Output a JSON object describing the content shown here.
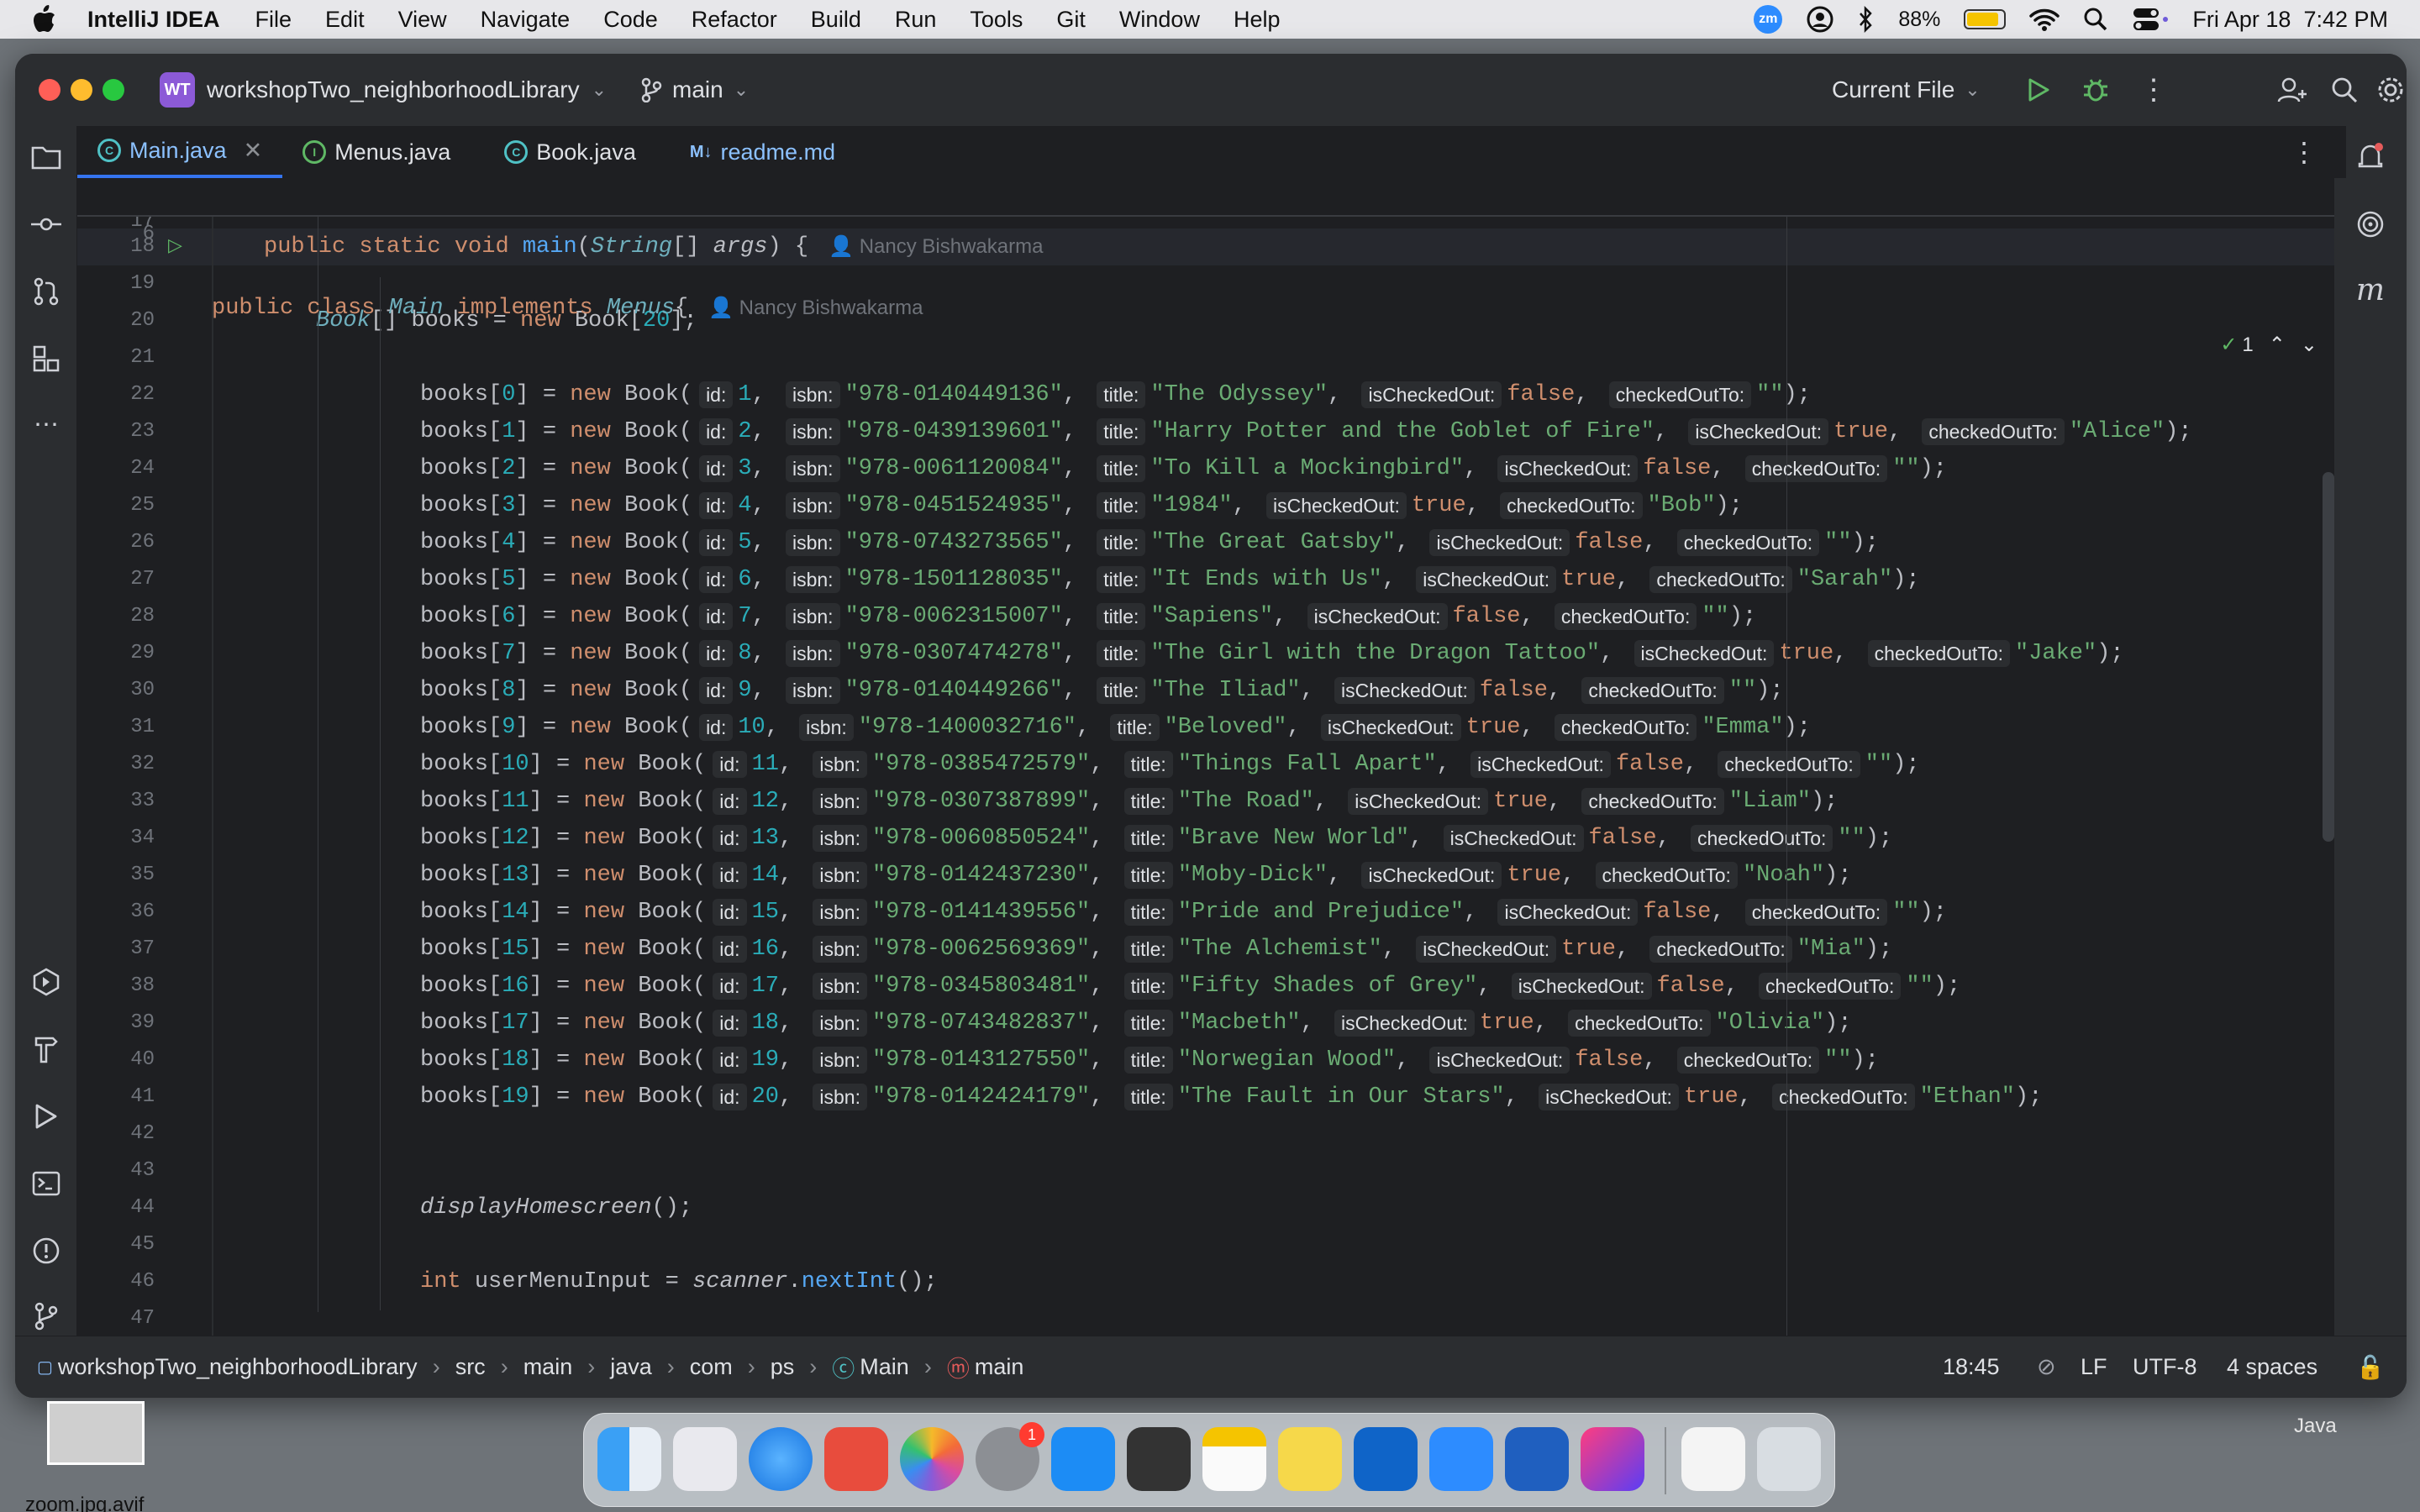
{
  "menubar": {
    "app_name": "IntelliJ IDEA",
    "items": [
      "File",
      "Edit",
      "View",
      "Navigate",
      "Code",
      "Refactor",
      "Build",
      "Run",
      "Tools",
      "Git",
      "Window",
      "Help"
    ],
    "battery": "88%",
    "battery_level": 0.88,
    "datetime": "Fri Apr 18  7:42 PM",
    "zoom_badge": "zm"
  },
  "titlebar": {
    "project_badge": "WT",
    "project_name": "workshopTwo_neighborhoodLibrary",
    "branch": "main",
    "run_config": "Current File"
  },
  "tabs": [
    {
      "label": "Main.java",
      "icon": "C",
      "active": true
    },
    {
      "label": "Menus.java",
      "icon": "I",
      "active": false
    },
    {
      "label": "Book.java",
      "icon": "C",
      "active": false
    },
    {
      "label": "readme.md",
      "icon": "M↓",
      "active": false
    }
  ],
  "editor": {
    "sticky": {
      "ln": "6",
      "l17": "17",
      "author": "Nancy Bishwakarma",
      "inspections": "1"
    },
    "main_line": {
      "ln": "18",
      "author": "Nancy Bishwakarma"
    },
    "hints": {
      "id": "id:",
      "isbn": "isbn:",
      "title": "title:",
      "isCheckedOut": "isCheckedOut:",
      "checkedOutTo": "checkedOutTo:"
    },
    "books": [
      {
        "ln": "22",
        "idx": "0",
        "id": "1",
        "isbn": "\"978-0140449136\"",
        "title": "\"The Odyssey\"",
        "out": "false",
        "to": "\"\""
      },
      {
        "ln": "23",
        "idx": "1",
        "id": "2",
        "isbn": "\"978-0439139601\"",
        "title": "\"Harry Potter and the Goblet of Fire\"",
        "out": "true",
        "to": "\"Alice\""
      },
      {
        "ln": "24",
        "idx": "2",
        "id": "3",
        "isbn": "\"978-0061120084\"",
        "title": "\"To Kill a Mockingbird\"",
        "out": "false",
        "to": "\"\""
      },
      {
        "ln": "25",
        "idx": "3",
        "id": "4",
        "isbn": "\"978-0451524935\"",
        "title": "\"1984\"",
        "out": "true",
        "to": "\"Bob\""
      },
      {
        "ln": "26",
        "idx": "4",
        "id": "5",
        "isbn": "\"978-0743273565\"",
        "title": "\"The Great Gatsby\"",
        "out": "false",
        "to": "\"\""
      },
      {
        "ln": "27",
        "idx": "5",
        "id": "6",
        "isbn": "\"978-1501128035\"",
        "title": "\"It Ends with Us\"",
        "out": "true",
        "to": "\"Sarah\""
      },
      {
        "ln": "28",
        "idx": "6",
        "id": "7",
        "isbn": "\"978-0062315007\"",
        "title": "\"Sapiens\"",
        "out": "false",
        "to": "\"\""
      },
      {
        "ln": "29",
        "idx": "7",
        "id": "8",
        "isbn": "\"978-0307474278\"",
        "title": "\"The Girl with the Dragon Tattoo\"",
        "out": "true",
        "to": "\"Jake\""
      },
      {
        "ln": "30",
        "idx": "8",
        "id": "9",
        "isbn": "\"978-0140449266\"",
        "title": "\"The Iliad\"",
        "out": "false",
        "to": "\"\""
      },
      {
        "ln": "31",
        "idx": "9",
        "id": "10",
        "isbn": "\"978-1400032716\"",
        "title": "\"Beloved\"",
        "out": "true",
        "to": "\"Emma\""
      },
      {
        "ln": "32",
        "idx": "10",
        "id": "11",
        "isbn": "\"978-0385472579\"",
        "title": "\"Things Fall Apart\"",
        "out": "false",
        "to": "\"\""
      },
      {
        "ln": "33",
        "idx": "11",
        "id": "12",
        "isbn": "\"978-0307387899\"",
        "title": "\"The Road\"",
        "out": "true",
        "to": "\"Liam\""
      },
      {
        "ln": "34",
        "idx": "12",
        "id": "13",
        "isbn": "\"978-0060850524\"",
        "title": "\"Brave New World\"",
        "out": "false",
        "to": "\"\""
      },
      {
        "ln": "35",
        "idx": "13",
        "id": "14",
        "isbn": "\"978-0142437230\"",
        "title": "\"Moby-Dick\"",
        "out": "true",
        "to": "\"Noah\""
      },
      {
        "ln": "36",
        "idx": "14",
        "id": "15",
        "isbn": "\"978-0141439556\"",
        "title": "\"Pride and Prejudice\"",
        "out": "false",
        "to": "\"\""
      },
      {
        "ln": "37",
        "idx": "15",
        "id": "16",
        "isbn": "\"978-0062569369\"",
        "title": "\"The Alchemist\"",
        "out": "true",
        "to": "\"Mia\""
      },
      {
        "ln": "38",
        "idx": "16",
        "id": "17",
        "isbn": "\"978-0345803481\"",
        "title": "\"Fifty Shades of Grey\"",
        "out": "false",
        "to": "\"\""
      },
      {
        "ln": "39",
        "idx": "17",
        "id": "18",
        "isbn": "\"978-0743482837\"",
        "title": "\"Macbeth\"",
        "out": "true",
        "to": "\"Olivia\""
      },
      {
        "ln": "40",
        "idx": "18",
        "id": "19",
        "isbn": "\"978-0143127550\"",
        "title": "\"Norwegian Wood\"",
        "out": "false",
        "to": "\"\""
      },
      {
        "ln": "41",
        "idx": "19",
        "id": "20",
        "isbn": "\"978-0142424179\"",
        "title": "\"The Fault in Our Stars\"",
        "out": "true",
        "to": "\"Ethan\""
      }
    ],
    "line_numbers_misc": {
      "l19": "19",
      "l20": "20",
      "l21": "21",
      "l42": "42",
      "l43": "43",
      "l44": "44",
      "l45": "45",
      "l46": "46",
      "l47": "47"
    }
  },
  "statusbar": {
    "crumbs": [
      "workshopTwo_neighborhoodLibrary",
      "src",
      "main",
      "java",
      "com",
      "ps",
      "Main",
      "main"
    ],
    "position": "18:45",
    "line_sep": "LF",
    "encoding": "UTF-8",
    "indent": "4 spaces"
  },
  "desktop": {
    "file_label": "zoom.jpg.avif",
    "dock_right_label": "Java",
    "settings_badge": "1"
  }
}
